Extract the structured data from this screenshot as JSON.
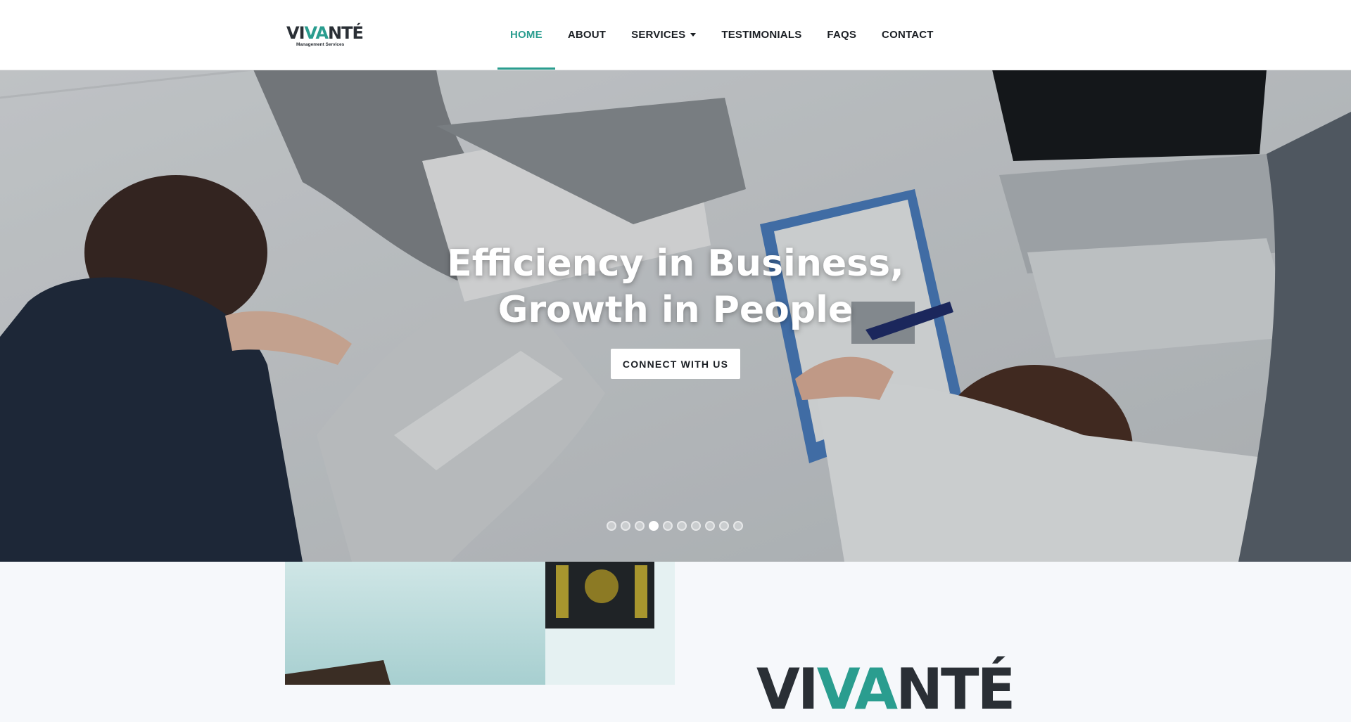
{
  "brand": {
    "logo_prefix": "VI",
    "logo_accent": "VA",
    "logo_suffix": "NTÉ",
    "tagline": "Management Services",
    "accent_color": "#2a9d8f"
  },
  "nav": {
    "items": [
      {
        "label": "HOME",
        "active": true
      },
      {
        "label": "ABOUT"
      },
      {
        "label": "SERVICES",
        "dropdown": true
      },
      {
        "label": "TESTIMONIALS"
      },
      {
        "label": "FAQS"
      },
      {
        "label": "CONTACT"
      }
    ]
  },
  "hero": {
    "title_line1": "Efficiency in Business,",
    "title_line2": "Growth in People",
    "cta_label": "CONNECT WITH US",
    "slide_count": 10,
    "active_slide": 4
  }
}
